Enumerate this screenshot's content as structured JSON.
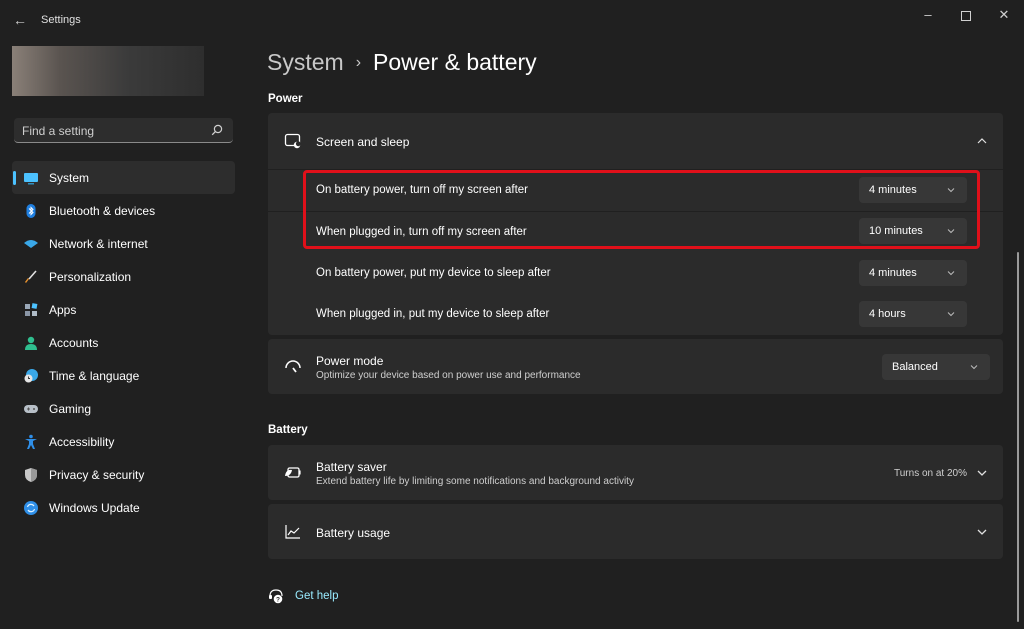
{
  "window": {
    "app_title": "Settings",
    "back_icon": "arrow-left-icon",
    "controls": {
      "minimize_icon": "minimize-icon",
      "maximize_icon": "maximize-icon",
      "close_icon": "close-icon"
    }
  },
  "search": {
    "placeholder": "Find a setting",
    "value": "",
    "icon": "search-icon"
  },
  "sidebar": {
    "items": [
      {
        "label": "System",
        "icon": "monitor-icon",
        "active": true
      },
      {
        "label": "Bluetooth & devices",
        "icon": "bluetooth-icon"
      },
      {
        "label": "Network & internet",
        "icon": "wifi-icon"
      },
      {
        "label": "Personalization",
        "icon": "brush-icon"
      },
      {
        "label": "Apps",
        "icon": "apps-icon"
      },
      {
        "label": "Accounts",
        "icon": "person-icon"
      },
      {
        "label": "Time & language",
        "icon": "clock-globe-icon"
      },
      {
        "label": "Gaming",
        "icon": "gamepad-icon"
      },
      {
        "label": "Accessibility",
        "icon": "accessibility-icon"
      },
      {
        "label": "Privacy & security",
        "icon": "shield-icon"
      },
      {
        "label": "Windows Update",
        "icon": "update-icon"
      }
    ]
  },
  "breadcrumb": {
    "parent": "System",
    "separator": "›",
    "current": "Power & battery"
  },
  "power": {
    "section_label": "Power",
    "screen_sleep": {
      "title": "Screen and sleep",
      "icon": "screen-sleep-icon",
      "expanded": true,
      "rows": [
        {
          "label": "On battery power, turn off my screen after",
          "value": "4 minutes"
        },
        {
          "label": "When plugged in, turn off my screen after",
          "value": "10 minutes"
        },
        {
          "label": "On battery power, put my device to sleep after",
          "value": "4 minutes"
        },
        {
          "label": "When plugged in, put my device to sleep after",
          "value": "4 hours"
        }
      ]
    },
    "power_mode": {
      "title": "Power mode",
      "subtitle": "Optimize your device based on power use and performance",
      "icon": "gauge-icon",
      "value": "Balanced"
    }
  },
  "battery": {
    "section_label": "Battery",
    "saver": {
      "title": "Battery saver",
      "subtitle": "Extend battery life by limiting some notifications and background activity",
      "status": "Turns on at 20%",
      "icon": "battery-saver-icon"
    },
    "usage": {
      "title": "Battery usage",
      "icon": "line-chart-icon"
    }
  },
  "help": {
    "label": "Get help",
    "icon": "help-icon"
  },
  "colors": {
    "accent": "#4cc2ff",
    "highlight_box": "#e0101a",
    "link": "#99ebff"
  }
}
